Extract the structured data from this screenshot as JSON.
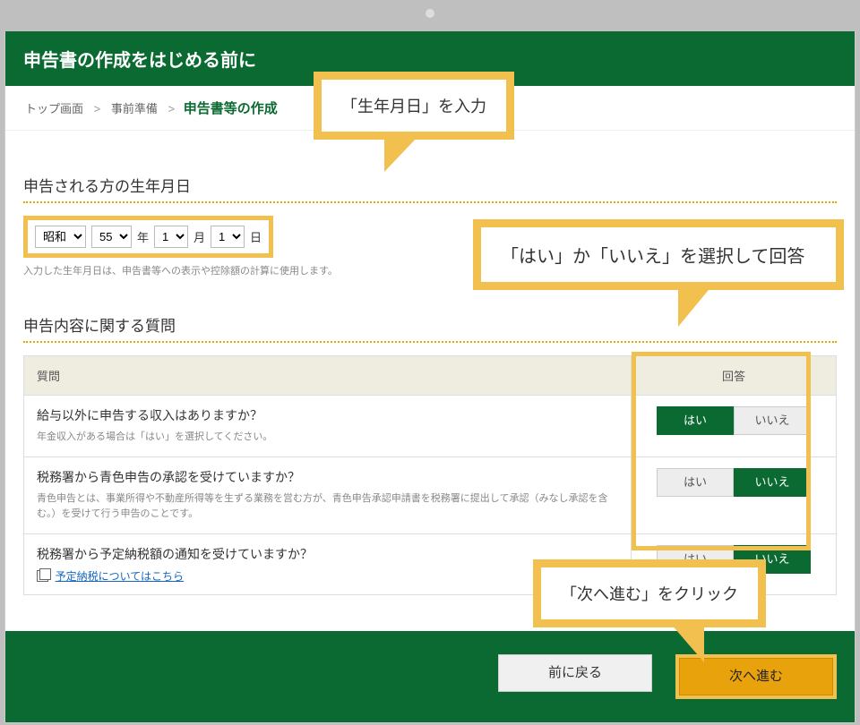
{
  "header": {
    "title": "申告書の作成をはじめる前に"
  },
  "breadcrumb": {
    "items": [
      "トップ画面",
      "事前準備"
    ],
    "current": "申告書等の作成",
    "separator": ">"
  },
  "callouts": {
    "dob": "「生年月日」を入力",
    "answer": "「はい」か「いいえ」を選択して回答",
    "next": "「次へ進む」をクリック"
  },
  "dob": {
    "section_title": "申告される方の生年月日",
    "era": {
      "options": [
        "昭和"
      ],
      "value": "昭和"
    },
    "year": {
      "options": [
        "55"
      ],
      "value": "55",
      "suffix": "年"
    },
    "month": {
      "options": [
        "1"
      ],
      "value": "1",
      "suffix": "月"
    },
    "day": {
      "options": [
        "1"
      ],
      "value": "1",
      "suffix": "日"
    },
    "note": "入力した生年月日は、申告書等への表示や控除額の計算に使用します。"
  },
  "questions": {
    "section_title": "申告内容に関する質問",
    "headers": {
      "question": "質問",
      "answer": "回答"
    },
    "yes_label": "はい",
    "no_label": "いいえ",
    "items": [
      {
        "main": "給与以外に申告する収入はありますか？",
        "sub": "年金収入がある場合は「はい」を選択してください。",
        "selected": "yes"
      },
      {
        "main": "税務署から青色申告の承認を受けていますか？",
        "sub": "青色申告とは、事業所得や不動産所得等を生ずる業務を営む方が、青色申告承認申請書を税務署に提出して承認（みなし承認を含む。）を受けて行う申告のことです。",
        "selected": "no"
      },
      {
        "main": "税務署から予定納税額の通知を受けていますか？",
        "link": "予定納税についてはこちら",
        "selected": "no"
      }
    ]
  },
  "footer": {
    "prev": "前に戻る",
    "next": "次へ進む"
  }
}
